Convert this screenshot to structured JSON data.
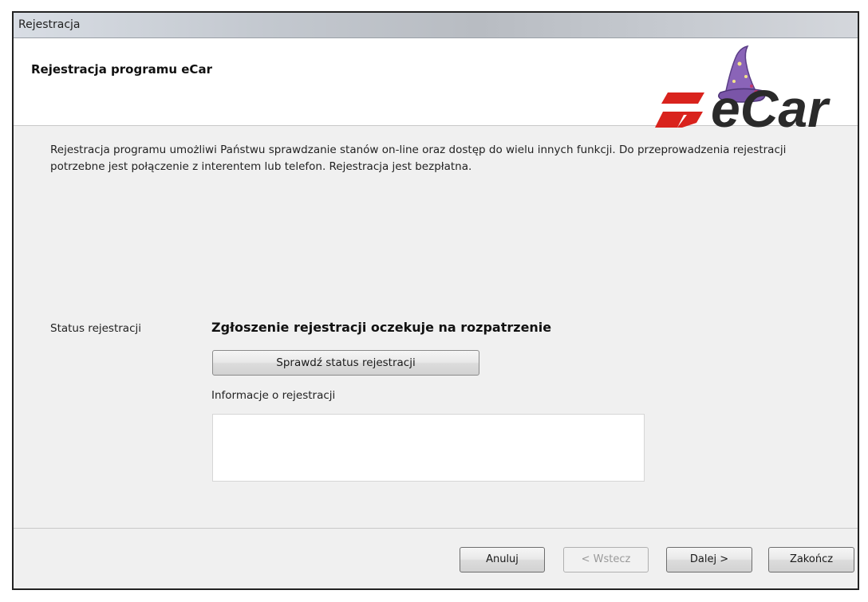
{
  "window": {
    "title": "Rejestracja"
  },
  "header": {
    "title": "Rejestracja programu eCar",
    "logo_text": "eCar"
  },
  "content": {
    "description": "Rejestracja programu umożliwi Państwu sprawdzanie stanów on-line oraz dostęp do wielu innych funkcji.  Do przeprowadzenia rejestracji potrzebne jest połączenie z interentem lub telefon.    Rejestracja jest bezpłatna.",
    "status_label": "Status rejestracji",
    "status_value": "Zgłoszenie rejestracji oczekuje na rozpatrzenie",
    "check_button_label": "Sprawdź status rejestracji",
    "info_label": "Informacje o rejestracji",
    "info_value": ""
  },
  "footer": {
    "cancel_label": "Anuluj",
    "back_label": "< Wstecz",
    "next_label": "Dalej >",
    "finish_label": "Zakończ"
  },
  "colors": {
    "logo_red": "#d9231d",
    "logo_text": "#2a2a2a",
    "hat_purple": "#8a64b8"
  }
}
